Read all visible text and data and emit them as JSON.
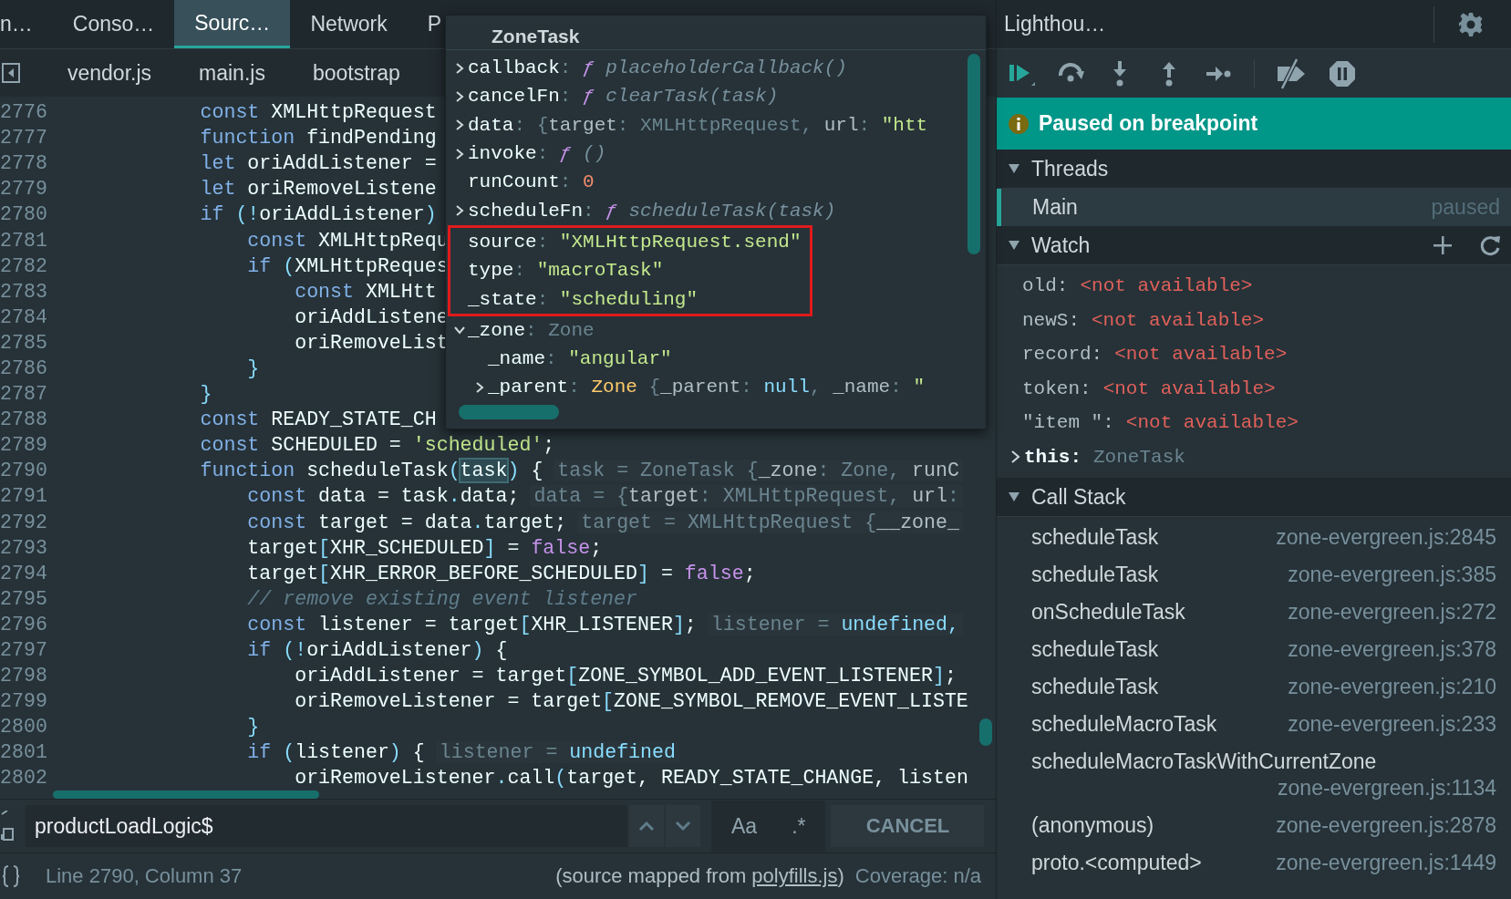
{
  "top_tabs": [
    {
      "label": "n…",
      "selected": false
    },
    {
      "label": "Conso…",
      "selected": false
    },
    {
      "label": "Sourc…",
      "selected": true
    },
    {
      "label": "Network",
      "selected": false
    },
    {
      "label": "P",
      "selected": false
    }
  ],
  "right_tab": "Lighthou…",
  "file_tabs": [
    {
      "label": "vendor.js"
    },
    {
      "label": "main.js"
    },
    {
      "label": "bootstrap"
    }
  ],
  "code": {
    "lines": [
      {
        "number": "2776",
        "parts": [
          {
            "kind": "keyword",
            "text": "            const"
          },
          {
            "kind": "name",
            "text": " XMLHttpRequest"
          }
        ]
      },
      {
        "number": "2777",
        "parts": [
          {
            "kind": "keyword",
            "text": "            function"
          },
          {
            "kind": "name",
            "text": " findPending"
          }
        ]
      },
      {
        "number": "2778",
        "parts": [
          {
            "kind": "keyword",
            "text": "            let"
          },
          {
            "kind": "name",
            "text": " oriAddListener ="
          }
        ]
      },
      {
        "number": "2779",
        "parts": [
          {
            "kind": "keyword",
            "text": "            let"
          },
          {
            "kind": "name",
            "text": " oriRemoveListene"
          }
        ]
      },
      {
        "number": "2780",
        "parts": [
          {
            "kind": "keyword",
            "text": "            if"
          },
          {
            "kind": "punct",
            "text": " (!"
          },
          {
            "kind": "name",
            "text": "oriAddListener"
          },
          {
            "kind": "punct",
            "text": ")"
          }
        ]
      },
      {
        "number": "2781",
        "parts": [
          {
            "kind": "keyword",
            "text": "                const"
          },
          {
            "kind": "name",
            "text": " XMLHttpRequ"
          }
        ]
      },
      {
        "number": "2782",
        "parts": [
          {
            "kind": "keyword",
            "text": "                if"
          },
          {
            "kind": "punct",
            "text": " ("
          },
          {
            "kind": "name",
            "text": "XMLHttpReques"
          }
        ]
      },
      {
        "number": "2783",
        "parts": [
          {
            "kind": "keyword",
            "text": "                    const"
          },
          {
            "kind": "name",
            "text": " XMLHtt"
          }
        ]
      },
      {
        "number": "2784",
        "parts": [
          {
            "kind": "name",
            "text": "                    oriAddListene"
          }
        ]
      },
      {
        "number": "2785",
        "parts": [
          {
            "kind": "name",
            "text": "                    oriRemoveList"
          }
        ]
      },
      {
        "number": "2786",
        "parts": [
          {
            "kind": "punct",
            "text": "                }"
          }
        ]
      },
      {
        "number": "2787",
        "parts": [
          {
            "kind": "punct",
            "text": "            }"
          }
        ]
      },
      {
        "number": "2788",
        "parts": [
          {
            "kind": "keyword",
            "text": "            const"
          },
          {
            "kind": "name",
            "text": " READY_STATE_CH"
          }
        ]
      },
      {
        "number": "2789",
        "parts": [
          {
            "kind": "keyword",
            "text": "            const"
          },
          {
            "kind": "name",
            "text": " SCHEDULED = "
          },
          {
            "kind": "string",
            "text": "'scheduled'"
          },
          {
            "kind": "name",
            "text": ";"
          }
        ]
      },
      {
        "number": "2790",
        "parts": [
          {
            "kind": "keyword",
            "text": "            function"
          },
          {
            "kind": "name",
            "text": " scheduleTask"
          },
          {
            "kind": "punct",
            "text": "("
          },
          {
            "kind": "selection",
            "text": "task"
          },
          {
            "kind": "punct",
            "text": ")"
          },
          {
            "kind": "name",
            "text": " {"
          }
        ],
        "hint": [
          {
            "kind": "dim",
            "text": "task = ZoneTask {"
          },
          {
            "kind": "key",
            "text": "_zone"
          },
          {
            "kind": "dim",
            "text": ": Zone, "
          },
          {
            "kind": "key",
            "text": "runC"
          }
        ]
      },
      {
        "number": "2791",
        "parts": [
          {
            "kind": "keyword",
            "text": "                const"
          },
          {
            "kind": "name",
            "text": " data = task"
          },
          {
            "kind": "punct",
            "text": "."
          },
          {
            "kind": "name",
            "text": "data;"
          }
        ],
        "hint": [
          {
            "kind": "dim",
            "text": "data = {"
          },
          {
            "kind": "key",
            "text": "target"
          },
          {
            "kind": "dim",
            "text": ": XMLHttpRequest, "
          },
          {
            "kind": "key",
            "text": "url"
          },
          {
            "kind": "dim",
            "text": ":"
          }
        ]
      },
      {
        "number": "2792",
        "parts": [
          {
            "kind": "keyword",
            "text": "                const"
          },
          {
            "kind": "name",
            "text": " target = data"
          },
          {
            "kind": "punct",
            "text": "."
          },
          {
            "kind": "name",
            "text": "target;"
          }
        ],
        "hint": [
          {
            "kind": "dim",
            "text": "target = XMLHttpRequest {"
          },
          {
            "kind": "key",
            "text": "__zone_"
          }
        ]
      },
      {
        "number": "2793",
        "parts": [
          {
            "kind": "name",
            "text": "                target"
          },
          {
            "kind": "punct",
            "text": "["
          },
          {
            "kind": "name",
            "text": "XHR_SCHEDULED"
          },
          {
            "kind": "punct",
            "text": "]"
          },
          {
            "kind": "name",
            "text": " = "
          },
          {
            "kind": "boolean",
            "text": "false"
          },
          {
            "kind": "name",
            "text": ";"
          }
        ]
      },
      {
        "number": "2794",
        "parts": [
          {
            "kind": "name",
            "text": "                target"
          },
          {
            "kind": "punct",
            "text": "["
          },
          {
            "kind": "name",
            "text": "XHR_ERROR_BEFORE_SCHEDULED"
          },
          {
            "kind": "punct",
            "text": "]"
          },
          {
            "kind": "name",
            "text": " = "
          },
          {
            "kind": "boolean",
            "text": "false"
          },
          {
            "kind": "name",
            "text": ";"
          }
        ]
      },
      {
        "number": "2795",
        "parts": [
          {
            "kind": "comment",
            "text": "                // remove existing event listener"
          }
        ]
      },
      {
        "number": "2796",
        "parts": [
          {
            "kind": "keyword",
            "text": "                const"
          },
          {
            "kind": "name",
            "text": " listener = target"
          },
          {
            "kind": "punct",
            "text": "["
          },
          {
            "kind": "name",
            "text": "XHR_LISTENER"
          },
          {
            "kind": "punct",
            "text": "]"
          },
          {
            "kind": "name",
            "text": ";"
          }
        ],
        "hint": [
          {
            "kind": "dim",
            "text": "listener = "
          },
          {
            "kind": "undefined",
            "text": "undefined,"
          }
        ]
      },
      {
        "number": "2797",
        "parts": [
          {
            "kind": "keyword",
            "text": "                if"
          },
          {
            "kind": "punct",
            "text": " (!"
          },
          {
            "kind": "name",
            "text": "oriAddListener"
          },
          {
            "kind": "punct",
            "text": ")"
          },
          {
            "kind": "name",
            "text": " {"
          }
        ]
      },
      {
        "number": "2798",
        "parts": [
          {
            "kind": "name",
            "text": "                    oriAddListener = target"
          },
          {
            "kind": "punct",
            "text": "["
          },
          {
            "kind": "name",
            "text": "ZONE_SYMBOL_ADD_EVENT_LISTENER"
          },
          {
            "kind": "punct",
            "text": "]"
          },
          {
            "kind": "name",
            "text": ";"
          }
        ]
      },
      {
        "number": "2799",
        "parts": [
          {
            "kind": "name",
            "text": "                    oriRemoveListener = target"
          },
          {
            "kind": "punct",
            "text": "["
          },
          {
            "kind": "name",
            "text": "ZONE_SYMBOL_REMOVE_EVENT_LISTE"
          }
        ]
      },
      {
        "number": "2800",
        "parts": [
          {
            "kind": "punct",
            "text": "                }"
          }
        ]
      },
      {
        "number": "2801",
        "parts": [
          {
            "kind": "keyword",
            "text": "                if"
          },
          {
            "kind": "punct",
            "text": " ("
          },
          {
            "kind": "name",
            "text": "listener"
          },
          {
            "kind": "punct",
            "text": ")"
          },
          {
            "kind": "name",
            "text": " {"
          }
        ],
        "hint": [
          {
            "kind": "dim",
            "text": "listener = "
          },
          {
            "kind": "undefined",
            "text": "undefined"
          }
        ]
      },
      {
        "number": "2802",
        "parts": [
          {
            "kind": "name",
            "text": "                    oriRemoveListener"
          },
          {
            "kind": "punct",
            "text": "."
          },
          {
            "kind": "name",
            "text": "call"
          },
          {
            "kind": "punct",
            "text": "("
          },
          {
            "kind": "name",
            "text": "target, READY_STATE_CHANGE, listen"
          }
        ]
      }
    ]
  },
  "popup": {
    "title": "ZoneTask",
    "properties": [
      {
        "expanded": false,
        "highlighted": false,
        "parts": [
          {
            "kind": "key",
            "text": "callback"
          },
          {
            "kind": "dim",
            "text": ": "
          },
          {
            "kind": "fsign",
            "text": "ƒ "
          },
          {
            "kind": "func",
            "text": "placeholderCallback()"
          }
        ]
      },
      {
        "expanded": false,
        "highlighted": false,
        "parts": [
          {
            "kind": "key",
            "text": "cancelFn"
          },
          {
            "kind": "dim",
            "text": ": "
          },
          {
            "kind": "fsign",
            "text": "ƒ "
          },
          {
            "kind": "func",
            "text": "clearTask(task)"
          }
        ]
      },
      {
        "expanded": false,
        "highlighted": false,
        "parts": [
          {
            "kind": "key",
            "text": "data"
          },
          {
            "kind": "dim",
            "text": ": {"
          },
          {
            "kind": "prop",
            "text": "target"
          },
          {
            "kind": "dim",
            "text": ": XMLHttpRequest, "
          },
          {
            "kind": "prop",
            "text": "url"
          },
          {
            "kind": "dim",
            "text": ": "
          },
          {
            "kind": "string",
            "text": "\"htt"
          }
        ]
      },
      {
        "expanded": false,
        "highlighted": false,
        "parts": [
          {
            "kind": "key",
            "text": "invoke"
          },
          {
            "kind": "dim",
            "text": ": "
          },
          {
            "kind": "fsign",
            "text": "ƒ "
          },
          {
            "kind": "func",
            "text": "()"
          }
        ]
      },
      {
        "highlighted": false,
        "parts": [
          {
            "kind": "key",
            "text": "runCount"
          },
          {
            "kind": "dim",
            "text": ": "
          },
          {
            "kind": "number",
            "text": "0"
          }
        ]
      },
      {
        "expanded": false,
        "highlighted": false,
        "parts": [
          {
            "kind": "key",
            "text": "scheduleFn"
          },
          {
            "kind": "dim",
            "text": ": "
          },
          {
            "kind": "fsign",
            "text": "ƒ "
          },
          {
            "kind": "func",
            "text": "scheduleTask(task)"
          }
        ]
      },
      {
        "highlighted": true,
        "parts": [
          {
            "kind": "key",
            "text": "source"
          },
          {
            "kind": "dim",
            "text": ": "
          },
          {
            "kind": "string",
            "text": "\"XMLHttpRequest.send\""
          }
        ]
      },
      {
        "highlighted": true,
        "parts": [
          {
            "kind": "key",
            "text": "type"
          },
          {
            "kind": "dim",
            "text": ": "
          },
          {
            "kind": "string",
            "text": "\"macroTask\""
          }
        ]
      },
      {
        "highlighted": true,
        "parts": [
          {
            "kind": "key",
            "text": "_state"
          },
          {
            "kind": "dim",
            "text": ": "
          },
          {
            "kind": "string",
            "text": "\"scheduling\""
          }
        ]
      },
      {
        "expanded": true,
        "highlighted": false,
        "parts": [
          {
            "kind": "key",
            "text": "_zone"
          },
          {
            "kind": "dim",
            "text": ": Zone"
          }
        ],
        "children": [
          {
            "highlighted": false,
            "parts": [
              {
                "kind": "key",
                "text": "_name"
              },
              {
                "kind": "dim",
                "text": ": "
              },
              {
                "kind": "string",
                "text": "\"angular\""
              }
            ]
          },
          {
            "expanded": false,
            "highlighted": false,
            "parts": [
              {
                "kind": "key",
                "text": "_parent"
              },
              {
                "kind": "dim",
                "text": ": "
              },
              {
                "kind": "zone",
                "text": "Zone "
              },
              {
                "kind": "dim",
                "text": "{"
              },
              {
                "kind": "prop",
                "text": "_parent"
              },
              {
                "kind": "dim",
                "text": ": "
              },
              {
                "kind": "null",
                "text": "null"
              },
              {
                "kind": "dim",
                "text": ", "
              },
              {
                "kind": "prop",
                "text": "_name"
              },
              {
                "kind": "dim",
                "text": ": "
              },
              {
                "kind": "string",
                "text": "\""
              }
            ]
          }
        ]
      }
    ]
  },
  "search": {
    "value": "productLoadLogic$",
    "case_button": "Aa",
    "regex_button": ".*",
    "cancel_button": "CANCEL"
  },
  "status_bar": {
    "position": "Line 2790, Column 37",
    "source_prefix": "(source mapped from ",
    "source_link": "polyfills.js",
    "source_suffix": ")",
    "coverage": "Coverage: n/a"
  },
  "debugger": {
    "banner": "Paused on breakpoint",
    "sections": [
      {
        "kind": "threads",
        "title": "Threads",
        "expanded": true,
        "items": [
          {
            "name": "Main",
            "state": "paused",
            "selected": true
          }
        ]
      },
      {
        "kind": "watch",
        "title": "Watch",
        "expanded": true,
        "items": [
          {
            "name": "old:",
            "value": "<not available>"
          },
          {
            "name": "newS:",
            "value": "<not available>"
          },
          {
            "name": "record:",
            "value": "<not available>"
          },
          {
            "name": "token:",
            "value": "<not available>"
          },
          {
            "name": "\"item \":",
            "value": "<not available>"
          },
          {
            "name": "this:",
            "value": "ZoneTask",
            "expanded": false
          }
        ]
      },
      {
        "kind": "callstack",
        "title": "Call Stack",
        "expanded": true,
        "items": [
          {
            "name": "scheduleTask",
            "location": "zone-evergreen.js:2845"
          },
          {
            "name": "scheduleTask",
            "location": "zone-evergreen.js:385"
          },
          {
            "name": "onScheduleTask",
            "location": "zone-evergreen.js:272"
          },
          {
            "name": "scheduleTask",
            "location": "zone-evergreen.js:378"
          },
          {
            "name": "scheduleTask",
            "location": "zone-evergreen.js:210"
          },
          {
            "name": "scheduleMacroTask",
            "location": "zone-evergreen.js:233"
          },
          {
            "name": "scheduleMacroTaskWithCurrentZone",
            "location": "zone-evergreen.js:1134"
          },
          {
            "name": "(anonymous)",
            "location": "zone-evergreen.js:2878"
          },
          {
            "name": "proto.<computed>",
            "location": "zone-evergreen.js:1449"
          }
        ]
      }
    ]
  }
}
